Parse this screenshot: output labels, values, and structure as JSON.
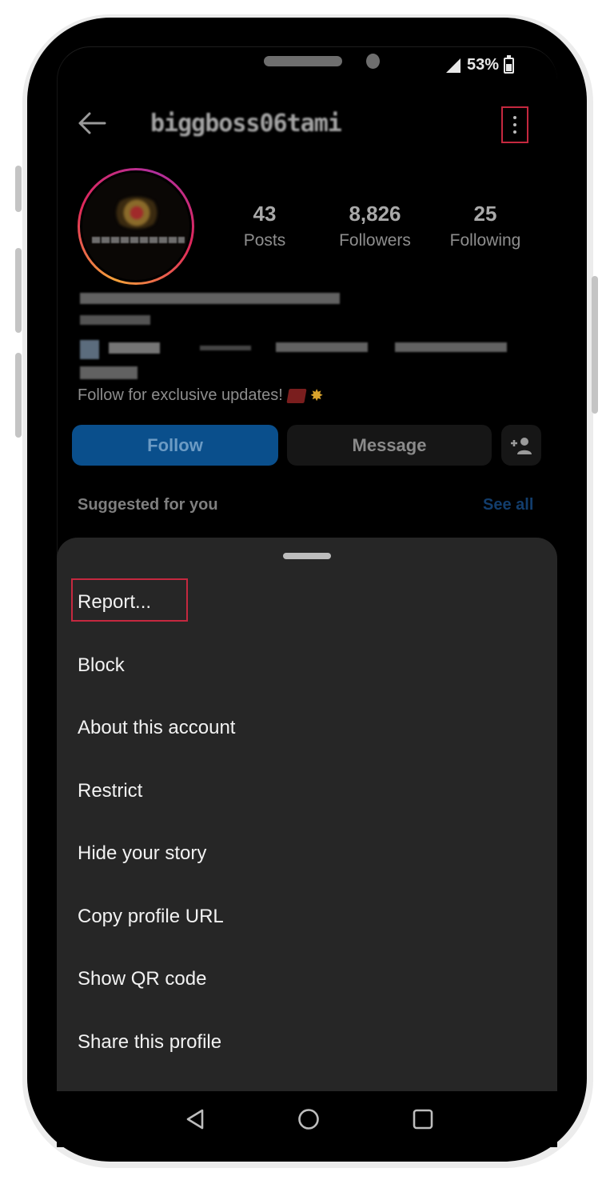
{
  "status_bar": {
    "battery_percent": "53%",
    "signal_icon": "signal-icon",
    "battery_icon": "battery-icon"
  },
  "header": {
    "back_icon": "arrow-left-icon",
    "username": "biggboss06tami",
    "more_icon": "more-vertical-icon"
  },
  "profile": {
    "stats": [
      {
        "value": "43",
        "label": "Posts"
      },
      {
        "value": "8,826",
        "label": "Followers"
      },
      {
        "value": "25",
        "label": "Following"
      }
    ],
    "bio_text": "Follow for exclusive updates!",
    "bio_emojis": [
      "💯",
      "💥"
    ]
  },
  "actions": {
    "follow_label": "Follow",
    "message_label": "Message",
    "add_user_icon": "person-add-icon"
  },
  "suggested": {
    "title": "Suggested for you",
    "see_all": "See all"
  },
  "menu": {
    "items": [
      {
        "label": "Report..."
      },
      {
        "label": "Block"
      },
      {
        "label": "About this account"
      },
      {
        "label": "Restrict"
      },
      {
        "label": "Hide your story"
      },
      {
        "label": "Copy profile URL"
      },
      {
        "label": "Show QR code"
      },
      {
        "label": "Share this profile"
      }
    ]
  },
  "navigation": {
    "back": "nav-back-icon",
    "home": "nav-home-icon",
    "recents": "nav-recents-icon"
  },
  "colors": {
    "highlight_box": "#c5283f",
    "follow_button": "#0a4f8c",
    "sheet_background": "#262626"
  }
}
